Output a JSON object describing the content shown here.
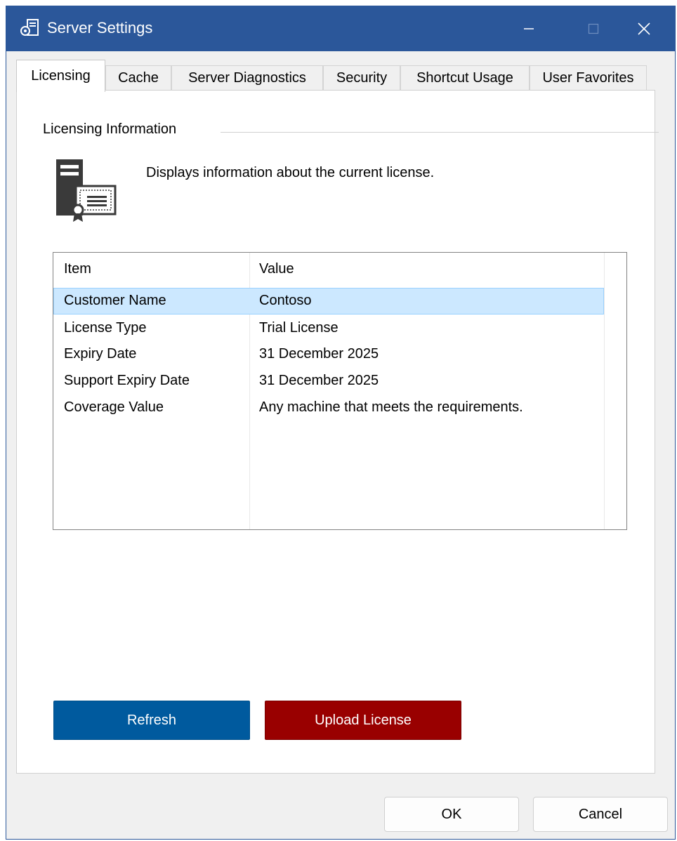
{
  "window": {
    "title": "Server Settings",
    "icon": "server-settings-icon"
  },
  "tabs": [
    {
      "label": "Licensing",
      "active": true
    },
    {
      "label": "Cache",
      "active": false
    },
    {
      "label": "Server Diagnostics",
      "active": false
    },
    {
      "label": "Security",
      "active": false
    },
    {
      "label": "Shortcut Usage",
      "active": false
    },
    {
      "label": "User Favorites",
      "active": false
    }
  ],
  "licensing": {
    "group_label": "Licensing Information",
    "description": "Displays information about the current license.",
    "icon": "license-certificate-icon",
    "table": {
      "columns": [
        "Item",
        "Value"
      ],
      "rows": [
        {
          "item": "Customer Name",
          "value": "Contoso",
          "selected": true
        },
        {
          "item": "License Type",
          "value": "Trial License",
          "selected": false
        },
        {
          "item": "Expiry Date",
          "value": "31 December 2025",
          "selected": false
        },
        {
          "item": "Support Expiry Date",
          "value": "31 December 2025",
          "selected": false
        },
        {
          "item": "Coverage Value",
          "value": "Any machine that meets the requirements.",
          "selected": false
        }
      ]
    },
    "refresh_label": "Refresh",
    "upload_label": "Upload License"
  },
  "footer": {
    "ok_label": "OK",
    "cancel_label": "Cancel"
  },
  "colors": {
    "titlebar": "#2b579a",
    "refresh_button": "#005a9e",
    "upload_button": "#990000",
    "selection": "#cce8ff"
  }
}
